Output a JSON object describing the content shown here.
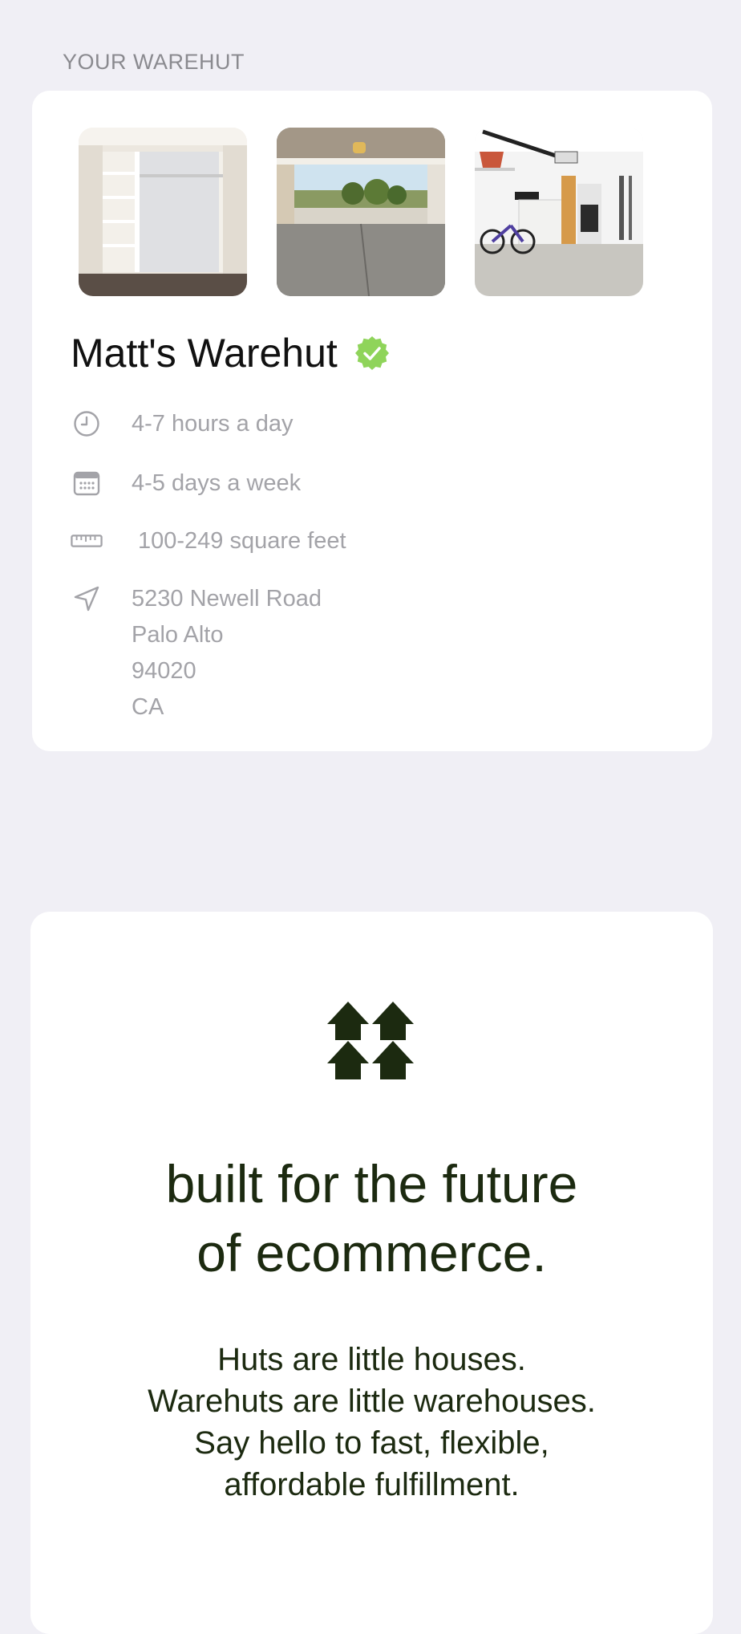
{
  "section": {
    "label": "YOUR WAREHUT"
  },
  "warehut": {
    "photos": [
      {
        "icon": "closet-photo"
      },
      {
        "icon": "open-garage-photo"
      },
      {
        "icon": "garage-storage-photo"
      }
    ],
    "name": "Matt's Warehut",
    "verified_icon": "verified-badge-icon",
    "hours": "4-7 hours a day",
    "days": "4-5 days a week",
    "size": "100-249 square feet",
    "address": {
      "street": "5230 Newell Road",
      "city": "Palo Alto",
      "zip": "94020",
      "state": "CA"
    }
  },
  "promo": {
    "logo_icon": "warehut-logo-icon",
    "headline_line1": "built for the future",
    "headline_line2": "of ecommerce.",
    "body_line1": "Huts are little houses.",
    "body_line2": "Warehuts are little warehouses.",
    "body_line3": "Say hello to fast, flexible,",
    "body_line4": "affordable fulfillment."
  },
  "colors": {
    "background": "#f0eff5",
    "card": "#ffffff",
    "verified_green": "#8fd45a",
    "brand_dark_green": "#1c2a10",
    "muted_text": "#a3a3a8"
  }
}
